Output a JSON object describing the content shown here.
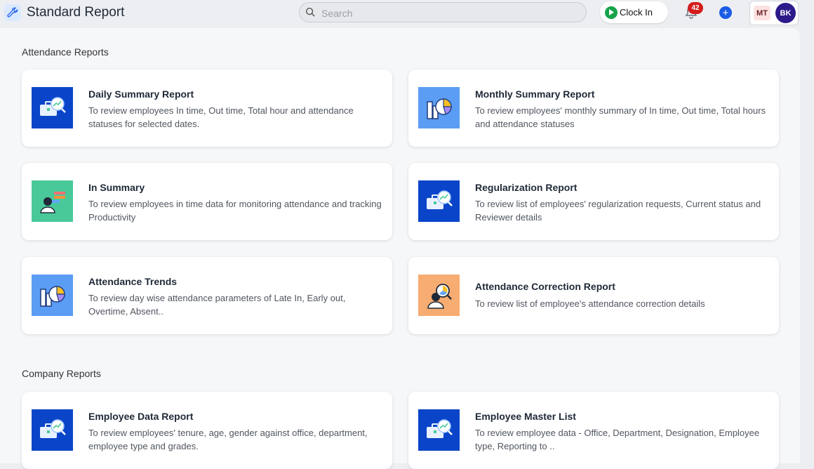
{
  "header": {
    "title": "Standard Report",
    "search_placeholder": "Search",
    "clock_in_label": "Clock In",
    "notification_count": "42",
    "avatar_initials_1": "MT",
    "avatar_initials_2": "BK"
  },
  "sections": [
    {
      "title": "Attendance Reports",
      "cards": [
        {
          "title": "Daily Summary Report",
          "description": "To review employees In time, Out time, Total hour and attendance statuses for selected dates.",
          "icon": "briefcase-chart-icon"
        },
        {
          "title": "Monthly Summary Report",
          "description": "To review employees' monthly summary of In time, Out time, Total hours and attendance statuses",
          "icon": "bar-pie-chart-icon"
        },
        {
          "title": "In Summary",
          "description": "To review employees in time data for monitoring attendance and tracking Productivity",
          "icon": "person-checklist-icon"
        },
        {
          "title": "Regularization Report",
          "description": "To review list of employees' regularization requests, Current status and Reviewer details",
          "icon": "briefcase-chart-icon"
        },
        {
          "title": "Attendance Trends",
          "description": "To review day wise attendance parameters of Late In, Early out, Overtime, Absent..",
          "icon": "bar-pie-chart-icon"
        },
        {
          "title": "Attendance Correction Report",
          "description": "To review list of employee's attendance correction details",
          "icon": "person-magnifier-icon"
        }
      ]
    },
    {
      "title": "Company Reports",
      "cards": [
        {
          "title": "Employee Data Report",
          "description": "To review employees' tenure, age, gender against office, department, employee type and grades.",
          "icon": "briefcase-chart-icon"
        },
        {
          "title": "Employee Master List",
          "description": "To review employee data - Office, Department, Designation, Employee type, Reporting to ..",
          "icon": "briefcase-chart-icon"
        }
      ]
    }
  ],
  "colors": {
    "icon_blue": "#0a45c9",
    "icon_light_blue": "#5b9cf4",
    "icon_green": "#49c99a",
    "icon_orange": "#f7ac71",
    "clock_in_green": "#17a34a",
    "badge_red": "#d41c1c"
  }
}
